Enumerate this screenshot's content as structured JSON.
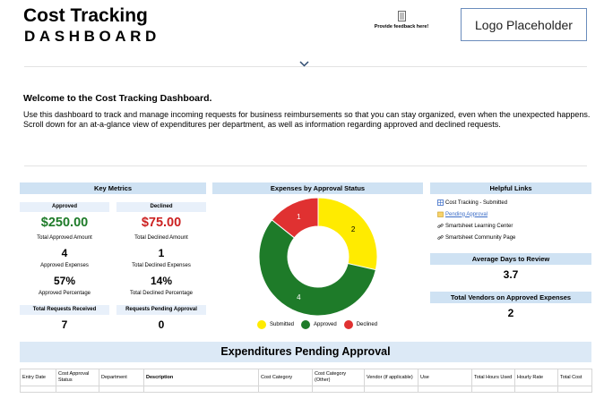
{
  "header": {
    "title": "Cost Tracking",
    "subtitle": "DASHBOARD",
    "feedback_label": "Provide feedback here!",
    "logo_text": "Logo Placeholder"
  },
  "welcome": {
    "heading": "Welcome to the Cost Tracking Dashboard.",
    "body": "Use this dashboard to track and manage incoming requests for business reimbursements so that you can stay organized, even when the unexpected happens. Scroll down for an at-a-glance view of expenditures per department, as well as information regarding approved and declined requests."
  },
  "key_metrics": {
    "title": "Key Metrics",
    "approved": {
      "label": "Approved",
      "amount": "$250.00",
      "amount_caption": "Total Approved Amount",
      "count": "4",
      "count_caption": "Approved Expenses",
      "percent": "57%",
      "percent_caption": "Approved Percentage"
    },
    "declined": {
      "label": "Declined",
      "amount": "$75.00",
      "amount_caption": "Total Declined Amount",
      "count": "1",
      "count_caption": "Total Declined Expenses",
      "percent": "14%",
      "percent_caption": "Total Declined Percentage"
    },
    "total_requests": {
      "label": "Total Requests Received",
      "value": "7"
    },
    "pending_requests": {
      "label": "Requests Pending Approval",
      "value": "0"
    }
  },
  "chart_panel_title": "Expenses by Approval Status",
  "chart_data": {
    "type": "pie",
    "donut": true,
    "title": "Expenses by Approval Status",
    "categories": [
      "Submitted",
      "Approved",
      "Declined"
    ],
    "values": [
      2,
      4,
      1
    ],
    "colors": [
      "#ffeb00",
      "#1e7b29",
      "#e03131"
    ],
    "legend": "bottom"
  },
  "helpful_links": {
    "title": "Helpful Links",
    "items": [
      {
        "label": "Cost Tracking - Submitted",
        "icon": "sheet-icon"
      },
      {
        "label": "Pending Approval",
        "icon": "folder-icon",
        "active": true
      },
      {
        "label": "Smartsheet Learning Center",
        "icon": "link-icon"
      },
      {
        "label": "Smartsheet Community Page",
        "icon": "link-icon"
      }
    ]
  },
  "avg_days": {
    "label": "Average Days to Review",
    "value": "3.7"
  },
  "total_vendors": {
    "label": "Total Vendors on Approved Expenses",
    "value": "2"
  },
  "pending_table": {
    "title": "Expenditures Pending Approval",
    "columns": [
      "Entry Date",
      "Cost Approval Status",
      "Department",
      "Description",
      "Cost Category",
      "Cost Category (Other)",
      "Vendor (if applicable)",
      "Use",
      "Total Hours Used",
      "Hourly Rate",
      "Total Cost"
    ]
  }
}
